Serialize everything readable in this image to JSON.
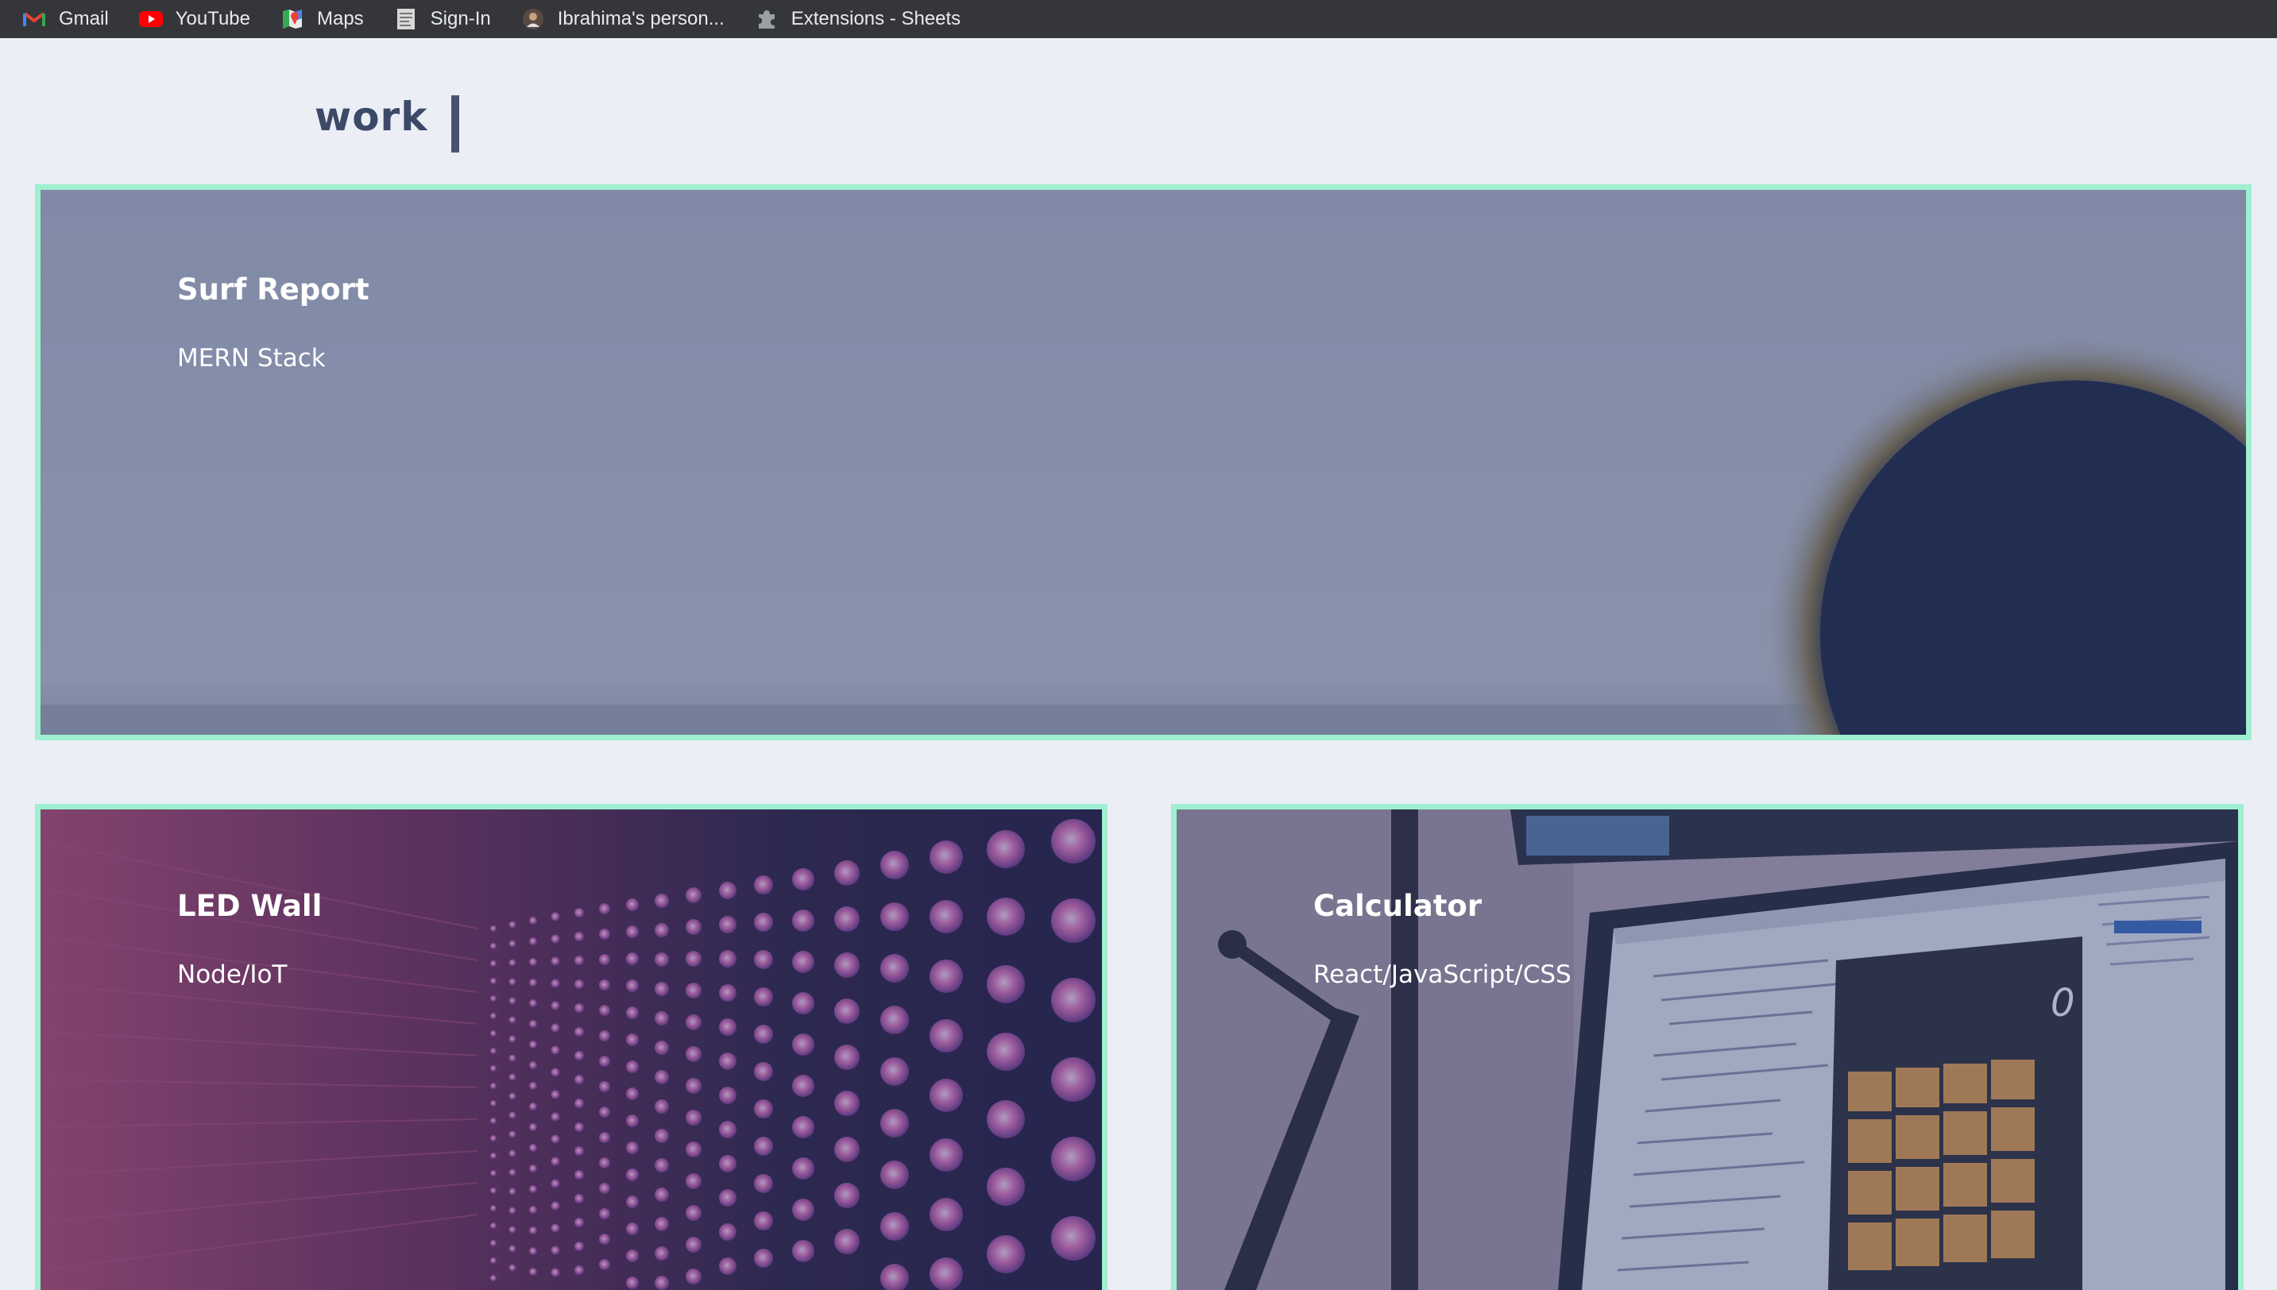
{
  "bookmarks": [
    {
      "label": "Gmail",
      "icon": "gmail-icon"
    },
    {
      "label": "YouTube",
      "icon": "youtube-icon"
    },
    {
      "label": "Maps",
      "icon": "maps-icon"
    },
    {
      "label": "Sign-In",
      "icon": "document-icon"
    },
    {
      "label": "Ibrahima's person...",
      "icon": "profile-avatar-icon"
    },
    {
      "label": "Extensions - Sheets",
      "icon": "puzzle-piece-icon"
    }
  ],
  "header": {
    "title": "work"
  },
  "projects": [
    {
      "title": "Surf Report",
      "stack": "MERN Stack"
    },
    {
      "title": "LED Wall",
      "stack": "Node/IoT"
    },
    {
      "title": "Calculator",
      "stack": "React/JavaScript/CSS"
    }
  ],
  "colors": {
    "background": "#eceef6",
    "card_border": "#9ff0d0",
    "heading": "#3c4a68",
    "bookmark_bar": "#35363a"
  }
}
